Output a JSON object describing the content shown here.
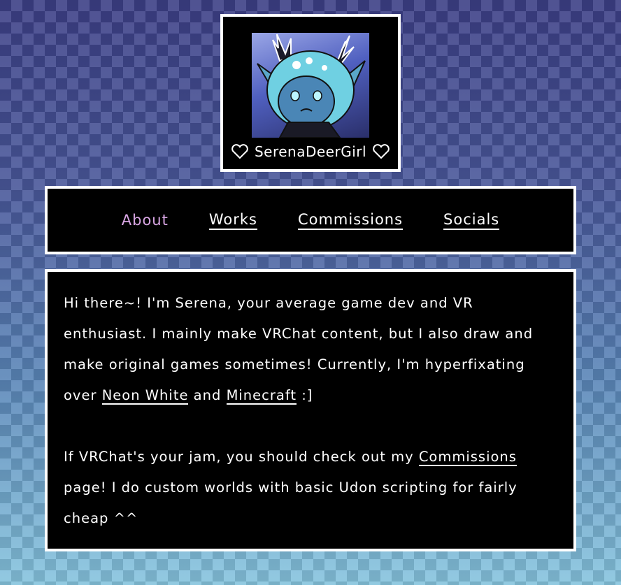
{
  "profile": {
    "name": "SerenaDeerGirl",
    "avatar_alt": "avatar-illustration"
  },
  "nav": {
    "items": [
      {
        "label": "About",
        "active": true
      },
      {
        "label": "Works",
        "active": false
      },
      {
        "label": "Commissions",
        "active": false
      },
      {
        "label": "Socials",
        "active": false
      }
    ]
  },
  "content": {
    "p1": {
      "text_before": "Hi there~! I'm Serena, your average game dev and VR enthusiast. I mainly make VRChat content, but I also draw and make original games sometimes! Currently, I'm hyperfixating over ",
      "link1": "Neon White",
      "between": " and ",
      "link2": "Minecraft",
      "after": " :]"
    },
    "p2": {
      "text_before": "If VRChat's your jam, you should check out my ",
      "link": "Commissions",
      "after": " page! I do custom worlds with basic Udon scripting for fairly cheap ^^"
    }
  },
  "colors": {
    "panel_bg": "#000000",
    "panel_border": "#ffffff",
    "active_nav": "#d9a6e4",
    "bg_top": "#3c3f86",
    "bg_bottom": "#86c4de"
  }
}
